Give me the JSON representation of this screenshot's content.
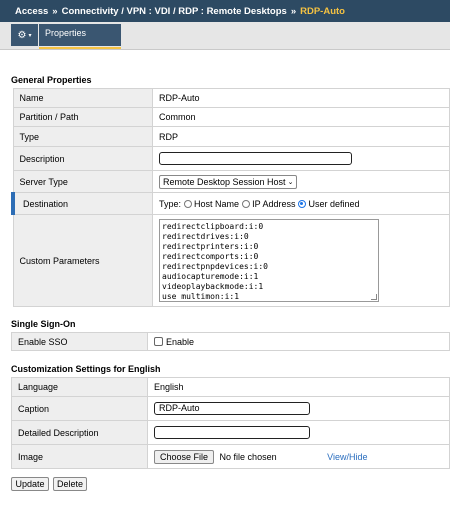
{
  "breadcrumb": {
    "items": [
      "Access",
      "Connectivity / VPN : VDI / RDP : Remote Desktops",
      "RDP-Auto"
    ],
    "separator": "»"
  },
  "toolbar": {
    "gear_icon": "gear-icon",
    "tab_label": "Properties"
  },
  "general": {
    "title": "General Properties",
    "name": {
      "label": "Name",
      "value": "RDP-Auto"
    },
    "partition": {
      "label": "Partition / Path",
      "value": "Common"
    },
    "type": {
      "label": "Type",
      "value": "RDP"
    },
    "description": {
      "label": "Description",
      "value": ""
    },
    "server_type": {
      "label": "Server Type",
      "value": "Remote Desktop Session Host"
    },
    "destination": {
      "label": "Destination",
      "type_label": "Type:",
      "options": [
        "Host Name",
        "IP Address",
        "User defined"
      ],
      "selected": "User defined"
    },
    "custom_params": {
      "label": "Custom Parameters",
      "lines": [
        "redirectclipboard:i:0",
        "redirectdrives:i:0",
        "redirectprinters:i:0",
        "redirectcomports:i:0",
        "redirectpnpdevices:i:0",
        "audiocapturemode:i:1",
        "videoplaybackmode:i:1",
        "use multimon:i:1"
      ]
    }
  },
  "sso": {
    "title": "Single Sign-On",
    "enable_label": "Enable SSO",
    "checkbox_label": "Enable",
    "checked": false
  },
  "custom": {
    "title": "Customization Settings for English",
    "language": {
      "label": "Language",
      "value": "English"
    },
    "caption": {
      "label": "Caption",
      "value": "RDP-Auto"
    },
    "detailed": {
      "label": "Detailed Description",
      "value": ""
    },
    "image": {
      "label": "Image",
      "button": "Choose File",
      "status": "No file chosen",
      "link": "View/Hide"
    }
  },
  "actions": {
    "update": "Update",
    "delete": "Delete"
  },
  "colors": {
    "header": "#2d4a63",
    "tab": "#3a5671",
    "accent": "#f5c242",
    "link": "#2a6ebf"
  }
}
